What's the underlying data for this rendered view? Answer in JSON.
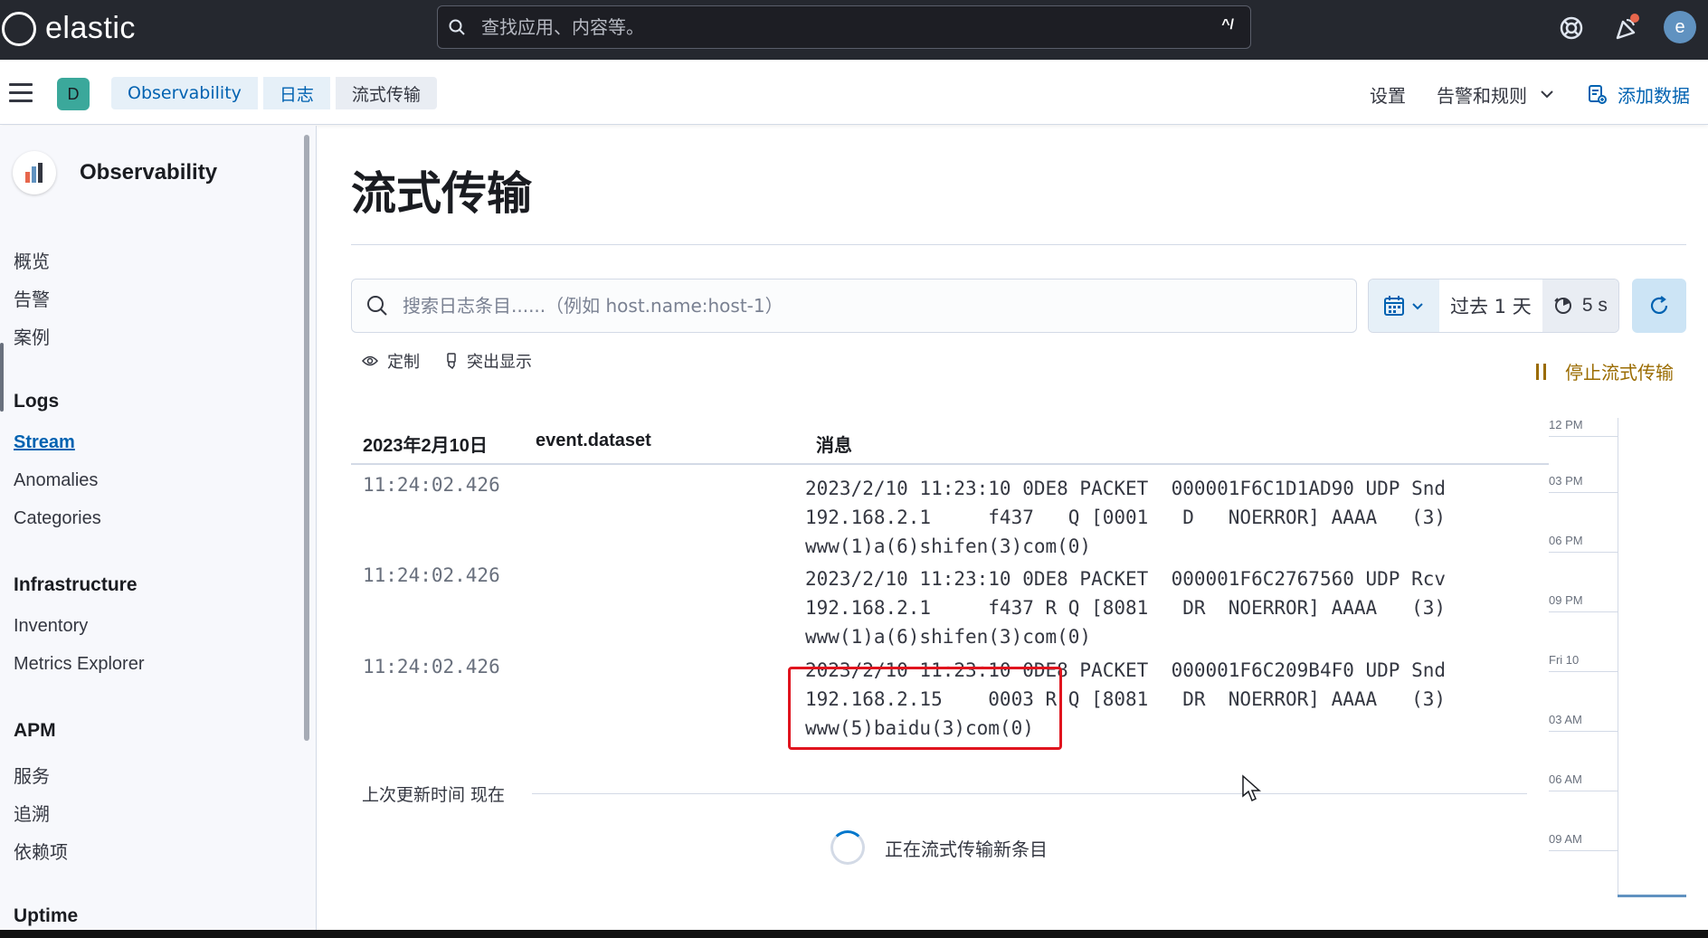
{
  "header": {
    "brand": "elastic",
    "search_placeholder": "查找应用、内容等。",
    "search_shortcut": "^/",
    "avatar_letter": "e"
  },
  "breadcrumbs": {
    "space_letter": "D",
    "items": [
      "Observability",
      "日志",
      "流式传输"
    ],
    "settings": "设置",
    "alerts": "告警和规则",
    "add_data": "添加数据"
  },
  "sidebar": {
    "title": "Observability",
    "top_items": [
      "概览",
      "告警",
      "案例"
    ],
    "groups": [
      {
        "label": "Logs",
        "items": [
          "Stream",
          "Anomalies",
          "Categories"
        ]
      },
      {
        "label": "Infrastructure",
        "items": [
          "Inventory",
          "Metrics Explorer"
        ]
      },
      {
        "label": "APM",
        "items": [
          "服务",
          "追溯",
          "依赖项"
        ]
      },
      {
        "label": "Uptime",
        "items": []
      }
    ],
    "active_item": "Stream"
  },
  "main": {
    "title": "流式传输",
    "search_placeholder": "搜索日志条目......（例如 host.name:host-1）",
    "date_range": "过去 1 天",
    "refresh_interval": "5 s",
    "customize": "定制",
    "highlight": "突出显示",
    "stop_streaming": "停止流式传输",
    "columns": [
      "2023年2月10日",
      "event.dataset",
      "消息"
    ],
    "rows": [
      {
        "time": "11:24:02.426",
        "lines": [
          "2023/2/10 11:23:10 0DE8 PACKET  000001F6C1D1AD90 UDP Snd",
          "192.168.2.1     f437   Q [0001   D   NOERROR] AAAA   (3)",
          "www(1)a(6)shifen(3)com(0)"
        ]
      },
      {
        "time": "11:24:02.426",
        "lines": [
          "2023/2/10 11:23:10 0DE8 PACKET  000001F6C2767560 UDP Rcv",
          "192.168.2.1     f437 R Q [8081   DR  NOERROR] AAAA   (3)",
          "www(1)a(6)shifen(3)com(0)"
        ]
      },
      {
        "time": "11:24:02.426",
        "lines": [
          "2023/2/10 11:23:10 0DE8 PACKET  000001F6C209B4F0 UDP Snd",
          "192.168.2.15    0003 R Q [8081   DR  NOERROR] AAAA   (3)",
          "www(5)baidu(3)com(0)"
        ]
      }
    ],
    "last_update": "上次更新时间 现在",
    "streaming_label": "正在流式传输新条目"
  },
  "minimap": {
    "ticks": [
      "12 PM",
      "03 PM",
      "06 PM",
      "09 PM",
      "Fri 10",
      "03 AM",
      "06 AM",
      "09 AM"
    ]
  },
  "colors": {
    "header_bg": "#25282f",
    "link": "#0062b1",
    "warning": "#9a6b00",
    "annotation_red": "#e0141e"
  }
}
